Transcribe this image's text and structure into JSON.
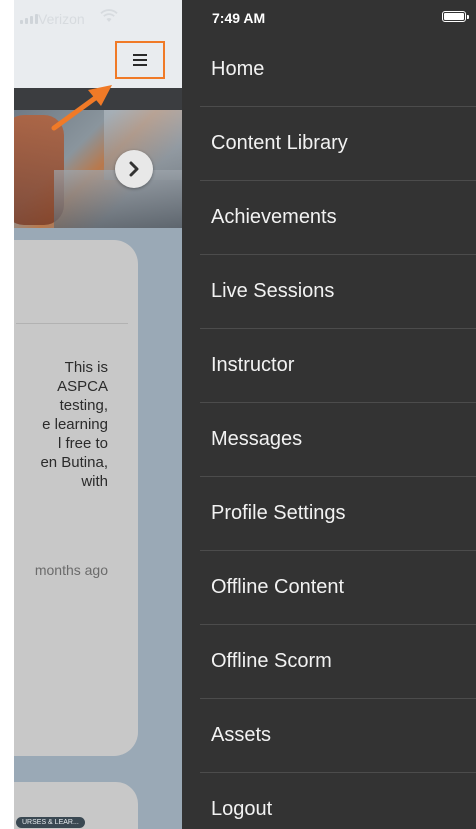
{
  "status_bar": {
    "carrier": "Verizon",
    "time": "7:49 AM"
  },
  "card": {
    "description_lines": [
      "This is",
      "ASPCA",
      "testing,",
      "e learning",
      "l free to",
      "en Butina,",
      "with"
    ],
    "timestamp": "months ago"
  },
  "card2": {
    "tag": "URSES & LEAR..."
  },
  "menu": {
    "items": [
      {
        "label": "Home"
      },
      {
        "label": "Content Library"
      },
      {
        "label": "Achievements"
      },
      {
        "label": "Live Sessions"
      },
      {
        "label": "Instructor"
      },
      {
        "label": "Messages"
      },
      {
        "label": "Profile Settings"
      },
      {
        "label": "Offline Content"
      },
      {
        "label": "Offline Scorm"
      },
      {
        "label": "Assets"
      },
      {
        "label": "Logout"
      }
    ]
  },
  "colors": {
    "menu_background": "#333333",
    "highlight_orange": "#f07a27",
    "content_background": "#9aa9b6"
  },
  "icons": {
    "menu": "hamburger-icon",
    "next": "chevron-right-icon",
    "annotation": "arrow-annotation-icon",
    "wifi": "wifi-icon",
    "battery": "battery-icon"
  }
}
